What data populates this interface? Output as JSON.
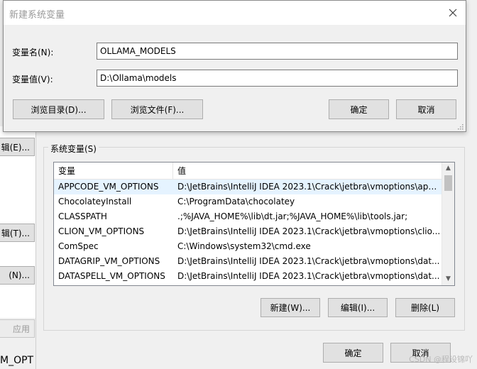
{
  "dialog": {
    "title": "新建系统变量",
    "name_label": "变量名(N):",
    "name_value": "OLLAMA_MODELS",
    "value_label": "变量值(V):",
    "value_value": "D:\\Ollama\\models",
    "browse_dir": "浏览目录(D)...",
    "browse_file": "浏览文件(F)...",
    "ok": "确定",
    "cancel": "取消"
  },
  "background": {
    "btn1": "辑(E)...",
    "btn2": "辑(T)...",
    "btn3": "(N)...",
    "apply": "应用",
    "bottom_text": "M_OPT"
  },
  "system_vars": {
    "group_label": "系统变量(S)",
    "col_variable": "变量",
    "col_value": "值",
    "rows": [
      {
        "name": "APPCODE_VM_OPTIONS",
        "value": "D:\\JetBrains\\IntelliJ IDEA 2023.1\\Crack\\jetbra\\vmoptions\\app..."
      },
      {
        "name": "ChocolateyInstall",
        "value": "C:\\ProgramData\\chocolatey"
      },
      {
        "name": "CLASSPATH",
        "value": ".;%JAVA_HOME%\\lib\\dt.jar;%JAVA_HOME%\\lib\\tools.jar;"
      },
      {
        "name": "CLION_VM_OPTIONS",
        "value": "D:\\JetBrains\\IntelliJ IDEA 2023.1\\Crack\\jetbra\\vmoptions\\clio..."
      },
      {
        "name": "ComSpec",
        "value": "C:\\Windows\\system32\\cmd.exe"
      },
      {
        "name": "DATAGRIP_VM_OPTIONS",
        "value": "D:\\JetBrains\\IntelliJ IDEA 2023.1\\Crack\\jetbra\\vmoptions\\dat..."
      },
      {
        "name": "DATASPELL_VM_OPTIONS",
        "value": "D:\\JetBrains\\IntelliJ IDEA 2023.1\\Crack\\jetbra\\vmoptions\\dat..."
      }
    ],
    "new_btn": "新建(W)...",
    "edit_btn": "编辑(I)...",
    "delete_btn": "删除(L)"
  },
  "footer": {
    "ok": "确定",
    "cancel": "取消",
    "watermark": "CSDN @程设锦吖"
  }
}
